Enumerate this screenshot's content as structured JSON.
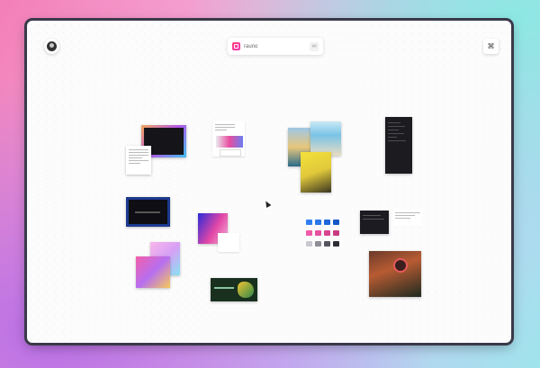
{
  "toolbar": {
    "search_value": "rauno"
  },
  "icons": {
    "avatar": "avatar-icon",
    "link": "link-icon",
    "command": "command-icon",
    "cursor": "cursor-icon"
  },
  "colors": {
    "accent": "#f03ab4",
    "swatches": [
      [
        "#2f7ff2",
        "#2b76e8",
        "#1f66d9",
        "#1457c4"
      ],
      [
        "#f05aa8",
        "#e74fa0",
        "#d9438f",
        "#c93a80"
      ],
      [
        "#c9c9cf",
        "#8e8e96",
        "#555560",
        "#2d2d35"
      ]
    ]
  }
}
